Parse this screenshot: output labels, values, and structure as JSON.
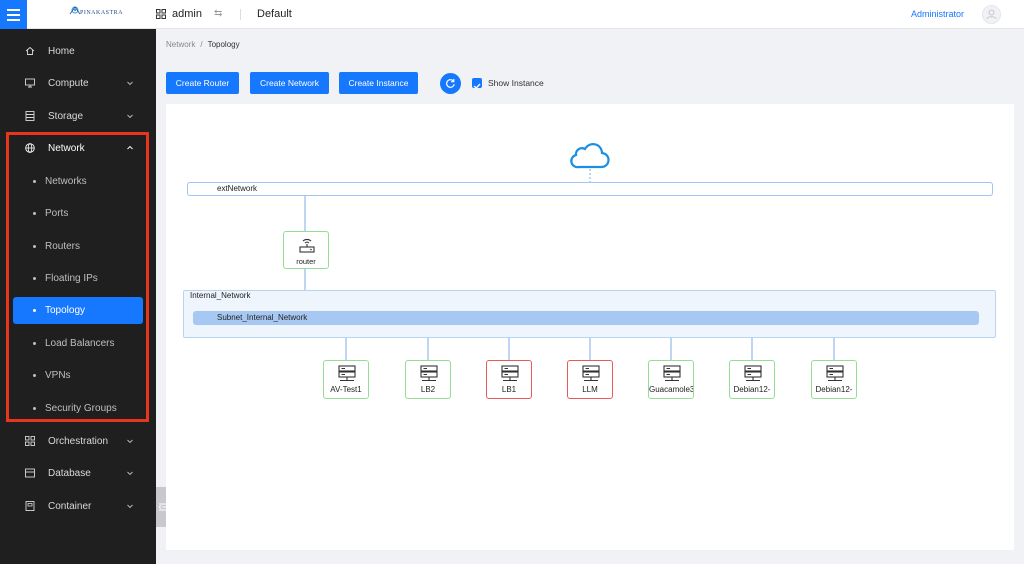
{
  "header": {
    "logo_text": "PINAKASTRA",
    "project": "admin",
    "domain": "Default",
    "user": "Administrator"
  },
  "sidebar": {
    "items": [
      {
        "label": "Home",
        "icon": "home-icon"
      },
      {
        "label": "Compute",
        "icon": "monitor-icon"
      },
      {
        "label": "Storage",
        "icon": "storage-icon"
      },
      {
        "label": "Network",
        "icon": "globe-icon",
        "expanded": true
      },
      {
        "label": "Orchestration",
        "icon": "grid-icon"
      },
      {
        "label": "Database",
        "icon": "database-icon"
      },
      {
        "label": "Container",
        "icon": "container-icon"
      }
    ],
    "network_subitems": [
      {
        "label": "Networks"
      },
      {
        "label": "Ports"
      },
      {
        "label": "Routers"
      },
      {
        "label": "Floating IPs"
      },
      {
        "label": "Topology",
        "active": true
      },
      {
        "label": "Load Balancers"
      },
      {
        "label": "VPNs"
      },
      {
        "label": "Security Groups"
      }
    ],
    "highlight_color": "#e8351d"
  },
  "breadcrumb": {
    "parent": "Network",
    "separator": "/",
    "current": "Topology"
  },
  "toolbar": {
    "create_router": "Create Router",
    "create_network": "Create Network",
    "create_instance": "Create Instance",
    "show_instance_label": "Show Instance",
    "show_instance_checked": true
  },
  "topology": {
    "external_network": "extNetwork",
    "router": "router",
    "internal_network": "Internal_Network",
    "subnet": "Subnet_Internal_Network",
    "instances": [
      {
        "label": "AV-Test1",
        "status": "ok"
      },
      {
        "label": "LB2",
        "status": "ok"
      },
      {
        "label": "LB1",
        "status": "error"
      },
      {
        "label": "LLM",
        "status": "error"
      },
      {
        "label": "Guacamole3",
        "status": "ok"
      },
      {
        "label": "Debian12-",
        "status": "ok"
      },
      {
        "label": "Debian12-",
        "status": "ok"
      }
    ]
  },
  "colors": {
    "accent": "#1677ff",
    "sidebar_bg": "#1f1f1f",
    "ok_border": "#95dd95",
    "error_border": "#e85a5a",
    "link_line": "#7aaee8"
  }
}
